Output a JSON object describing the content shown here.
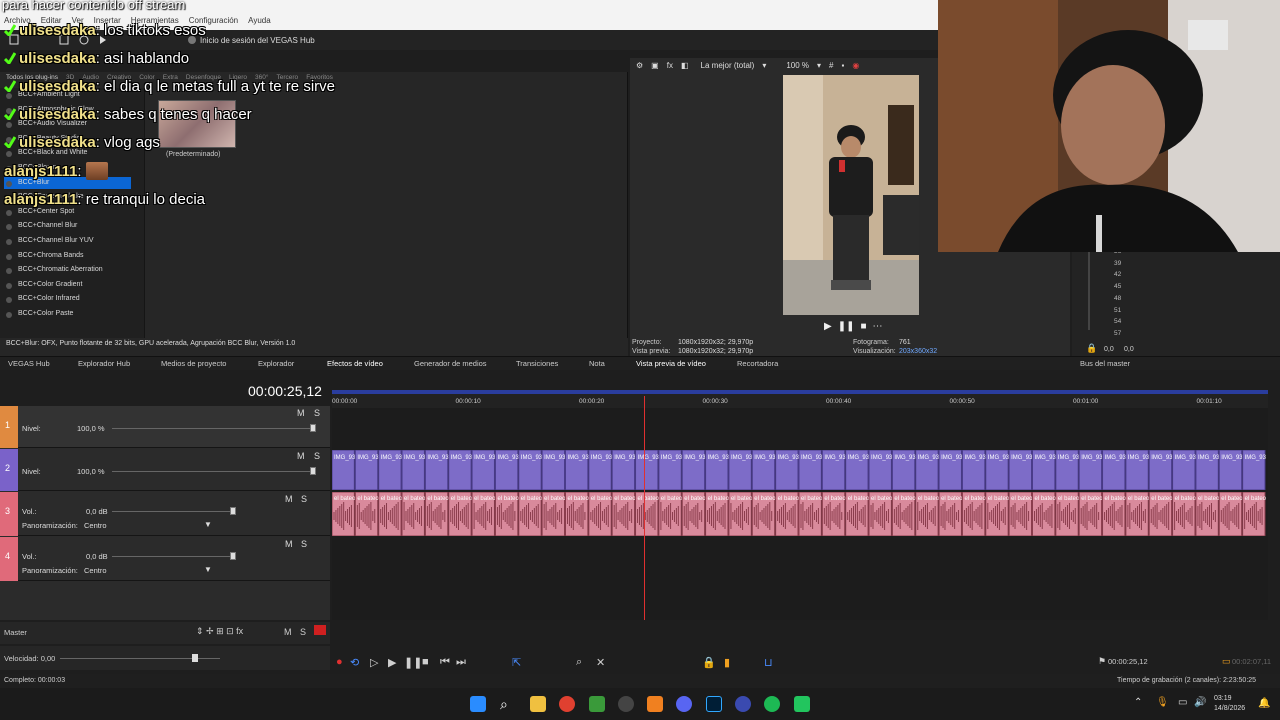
{
  "stream": {
    "title": "para hacer contenido off stream"
  },
  "menu": [
    "Archivo",
    "Editar",
    "Ver",
    "Insertar",
    "Herramientas",
    "Configuración",
    "Ayuda"
  ],
  "hub": {
    "login": "Inicio de sesión del VEGAS Hub"
  },
  "fx_tabs": [
    "Todos los plug-ins",
    "3D",
    "Audio",
    "Creativo",
    "Color",
    "Extra",
    "Desenfoque",
    "Ligero",
    "360°",
    "Tercero",
    "Favoritos"
  ],
  "fx_list": [
    "BCC+Ambient Light",
    "BCC+Atmospheric Glow",
    "BCC+Audio Visualizer",
    "BCC+Beauty Studio",
    "BCC+Black and White",
    "BCC+Bloom",
    "BCC+Blur",
    "BCC+Camera Shake",
    "BCC+Center Spot",
    "BCC+Channel Blur",
    "BCC+Channel Blur YUV",
    "BCC+Chroma Bands",
    "BCC+Chromatic Aberration",
    "BCC+Color Gradient",
    "BCC+Color Infrared",
    "BCC+Color Paste"
  ],
  "preset": {
    "label": "(Predeterminado)"
  },
  "fx_status": "BCC+Blur: OFX, Punto flotante de 32 bits, GPU acelerada, Agrupación BCC Blur, Versión 1.0",
  "preview": {
    "quality": "La mejor (total)",
    "zoom": "100 %",
    "proyecto_label": "Proyecto:",
    "proyecto_value": "1080x1920x32; 29,970p",
    "vista_label": "Vista previa:",
    "vista_value": "1080x1920x32; 29,970p",
    "fotograma_label": "Fotograma:",
    "fotograma_value": "761",
    "visual_label": "Visualización:",
    "visual_value": "203x360x32"
  },
  "meter": {
    "scale": [
      "36",
      "39",
      "42",
      "45",
      "48",
      "51",
      "54",
      "57"
    ],
    "left": "0,0",
    "right": "0,0"
  },
  "tabs": [
    "VEGAS Hub",
    "Explorador Hub",
    "Medios de proyecto",
    "Explorador",
    "Efectos de vídeo",
    "Generador de medios",
    "Transiciones",
    "Nota",
    "Vista previa de vídeo",
    "Recortadora",
    "Bus del master"
  ],
  "timeline": {
    "timecode": "00:00:25,12",
    "ticks": [
      "00:00:00",
      "00:00:10",
      "00:00:20",
      "00:00:30",
      "00:00:40",
      "00:00:50",
      "00:01:00",
      "00:01:10"
    ],
    "tracks": [
      {
        "num": "1",
        "label": "Nivel:",
        "value": "100,0 %",
        "m": "M",
        "s": "S"
      },
      {
        "num": "2",
        "label": "Nivel:",
        "value": "100,0 %",
        "m": "M",
        "s": "S"
      },
      {
        "num": "3",
        "label": "Vol.:",
        "value": "0,0 dB",
        "pan_label": "Panoramización:",
        "pan_value": "Centro",
        "m": "M",
        "s": "S"
      },
      {
        "num": "4",
        "label": "Vol.:",
        "value": "0,0 dB",
        "pan_label": "Panoramización:",
        "pan_value": "Centro",
        "m": "M",
        "s": "S"
      }
    ],
    "clip_name": "IMG_9382",
    "audio_clip_name": "el bateo",
    "master_label": "Master",
    "speed_label": "Velocidad: 0,00",
    "end_time": "00:00:25,12",
    "end_time_right": "00:02:07,11"
  },
  "status": {
    "left": "Completo: 00:00:03",
    "right": "Tiempo de grabación (2 canales): 2:23:50:25"
  },
  "taskbar": {
    "time": "03:19",
    "date": "14/8/2026"
  },
  "chat": [
    {
      "user": "ulisesdaka",
      "msg": ": los tiktoks esos"
    },
    {
      "user": "ulisesdaka",
      "msg": ": asi hablando"
    },
    {
      "user": "ulisesdaka",
      "msg": ": el dia q le metas full a yt te re sirve"
    },
    {
      "user": "ulisesdaka",
      "msg": ": sabes q tenes q hacer"
    },
    {
      "user": "ulisesdaka",
      "msg": ": vlog ags"
    },
    {
      "user": "alanjs1111",
      "msg": ":"
    },
    {
      "user": "alanjs1111",
      "msg": ": re tranqui lo decia"
    }
  ]
}
